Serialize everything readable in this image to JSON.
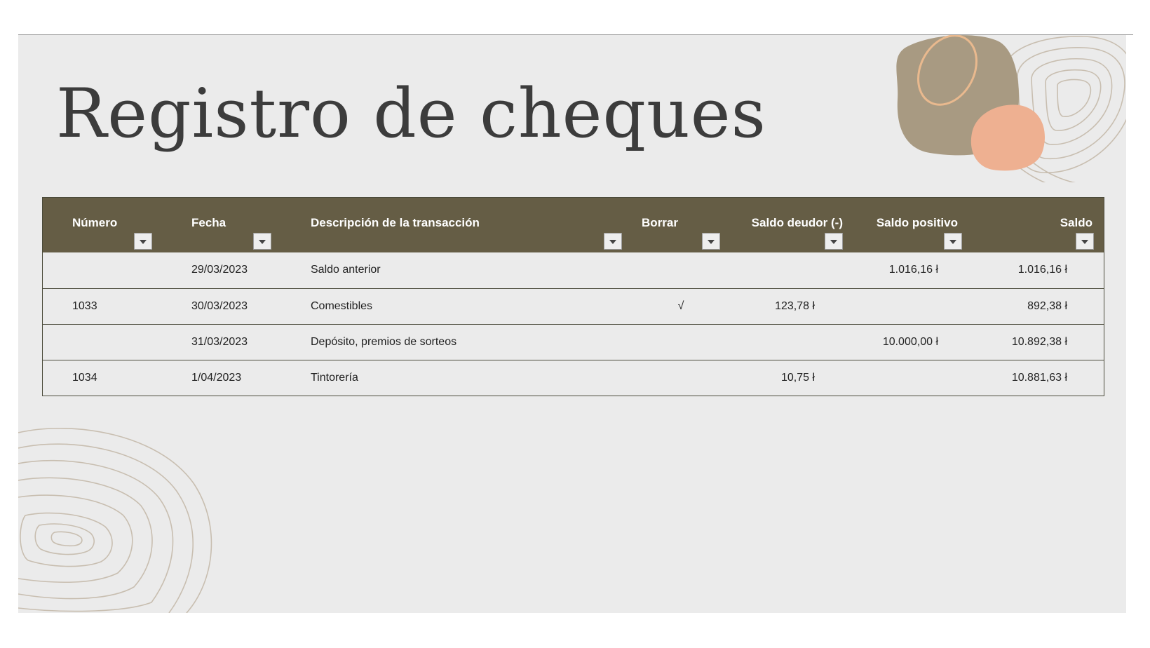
{
  "title": "Registro de cheques",
  "register": {
    "columns": [
      "Número",
      "Fecha",
      "Descripción de la transacción",
      "Borrar",
      "Saldo deudor (-)",
      "Saldo positivo",
      "Saldo"
    ],
    "rows": [
      {
        "number": "",
        "date": "29/03/2023",
        "description": "Saldo anterior",
        "cleared": "",
        "debit": "",
        "credit": "1.016,16 ł",
        "balance": "1.016,16 ł"
      },
      {
        "number": "1033",
        "date": "30/03/2023",
        "description": "Comestibles",
        "cleared": "√",
        "debit": "123,78 ł",
        "credit": "",
        "balance": "892,38 ł"
      },
      {
        "number": "",
        "date": "31/03/2023",
        "description": "Depósito, premios de sorteos",
        "cleared": "",
        "debit": "",
        "credit": "10.000,00 ł",
        "balance": "10.892,38 ł"
      },
      {
        "number": "1034",
        "date": "1/04/2023",
        "description": "Tintorería",
        "cleared": "",
        "debit": "10,75 ł",
        "credit": "",
        "balance": "10.881,63 ł"
      }
    ]
  },
  "colors": {
    "header_bg": "#655d45",
    "sheet_bg": "#ebebeb",
    "stone_taupe": "#a89a82",
    "stone_peach": "#eeb091",
    "contour_lines": "#c8beb0"
  }
}
